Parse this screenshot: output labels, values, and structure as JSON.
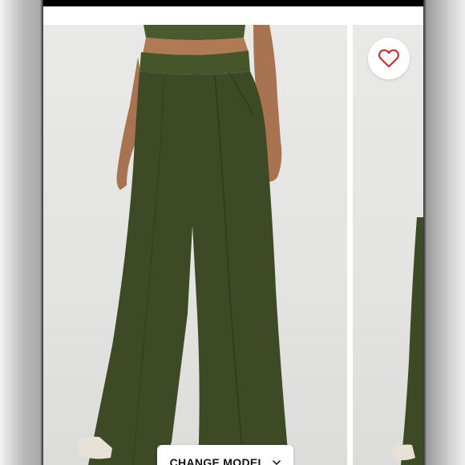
{
  "product_viewer": {
    "favorite_icon": "heart-outline-icon",
    "change_model_label": "CHANGE MODEL",
    "change_model_icon": "chevron-down-icon"
  },
  "colors": {
    "accent_heart": "#c0332e",
    "pants": "#3d4a25",
    "background": "#e6e6e4"
  }
}
